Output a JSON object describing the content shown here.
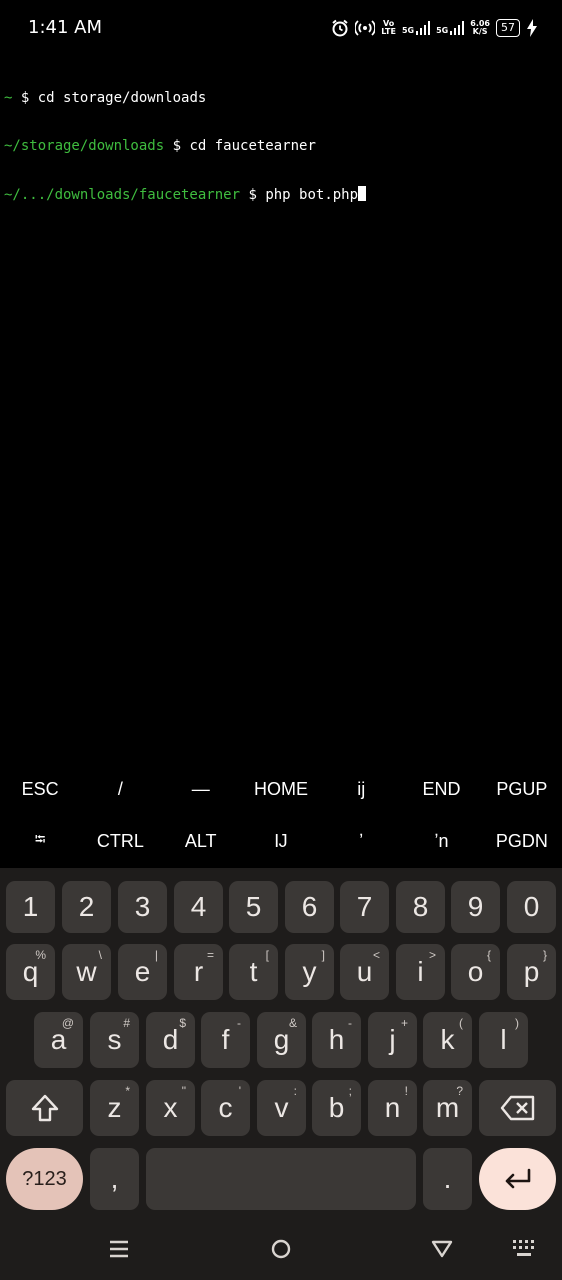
{
  "status": {
    "time": "1:41 AM",
    "vo_lte": "Vo\nLTE",
    "net1": "5G",
    "net2": "5G",
    "speed_value": "6.06",
    "speed_unit": "K/S",
    "battery": "57"
  },
  "terminal": {
    "lines": [
      {
        "prompt": "~",
        "sep": " $ ",
        "cmd": "cd storage/downloads"
      },
      {
        "prompt": "~/storage/downloads",
        "sep": " $ ",
        "cmd": "cd faucetearner"
      },
      {
        "prompt": "~/.../downloads/faucetearner",
        "sep": " $ ",
        "cmd": "php bot.php"
      }
    ]
  },
  "extra_keys": {
    "row1": [
      "ESC",
      "/",
      "—",
      "HOME",
      "ij",
      "END",
      "PGUP"
    ],
    "row2": [
      "⭾",
      "CTRL",
      "ALT",
      "Ĳ",
      "ʼ",
      "ʼn",
      "PGDN"
    ]
  },
  "keyboard": {
    "numbers": [
      "1",
      "2",
      "3",
      "4",
      "5",
      "6",
      "7",
      "8",
      "9",
      "0"
    ],
    "row_q": [
      {
        "k": "q",
        "s": "%"
      },
      {
        "k": "w",
        "s": "\\"
      },
      {
        "k": "e",
        "s": "|"
      },
      {
        "k": "r",
        "s": "="
      },
      {
        "k": "t",
        "s": "["
      },
      {
        "k": "y",
        "s": "]"
      },
      {
        "k": "u",
        "s": "<"
      },
      {
        "k": "i",
        "s": ">"
      },
      {
        "k": "o",
        "s": "{"
      },
      {
        "k": "p",
        "s": "}"
      }
    ],
    "row_a": [
      {
        "k": "a",
        "s": "@"
      },
      {
        "k": "s",
        "s": "#"
      },
      {
        "k": "d",
        "s": "$"
      },
      {
        "k": "f",
        "s": "-"
      },
      {
        "k": "g",
        "s": "&"
      },
      {
        "k": "h",
        "s": "-"
      },
      {
        "k": "j",
        "s": "+"
      },
      {
        "k": "k",
        "s": "("
      },
      {
        "k": "l",
        "s": ")"
      }
    ],
    "row_z": [
      {
        "k": "z",
        "s": "*"
      },
      {
        "k": "x",
        "s": "\""
      },
      {
        "k": "c",
        "s": "'"
      },
      {
        "k": "v",
        "s": ":"
      },
      {
        "k": "b",
        "s": ";"
      },
      {
        "k": "n",
        "s": "!"
      },
      {
        "k": "m",
        "s": "?"
      }
    ],
    "symbols_label": "?123",
    "comma": ",",
    "period": "."
  }
}
